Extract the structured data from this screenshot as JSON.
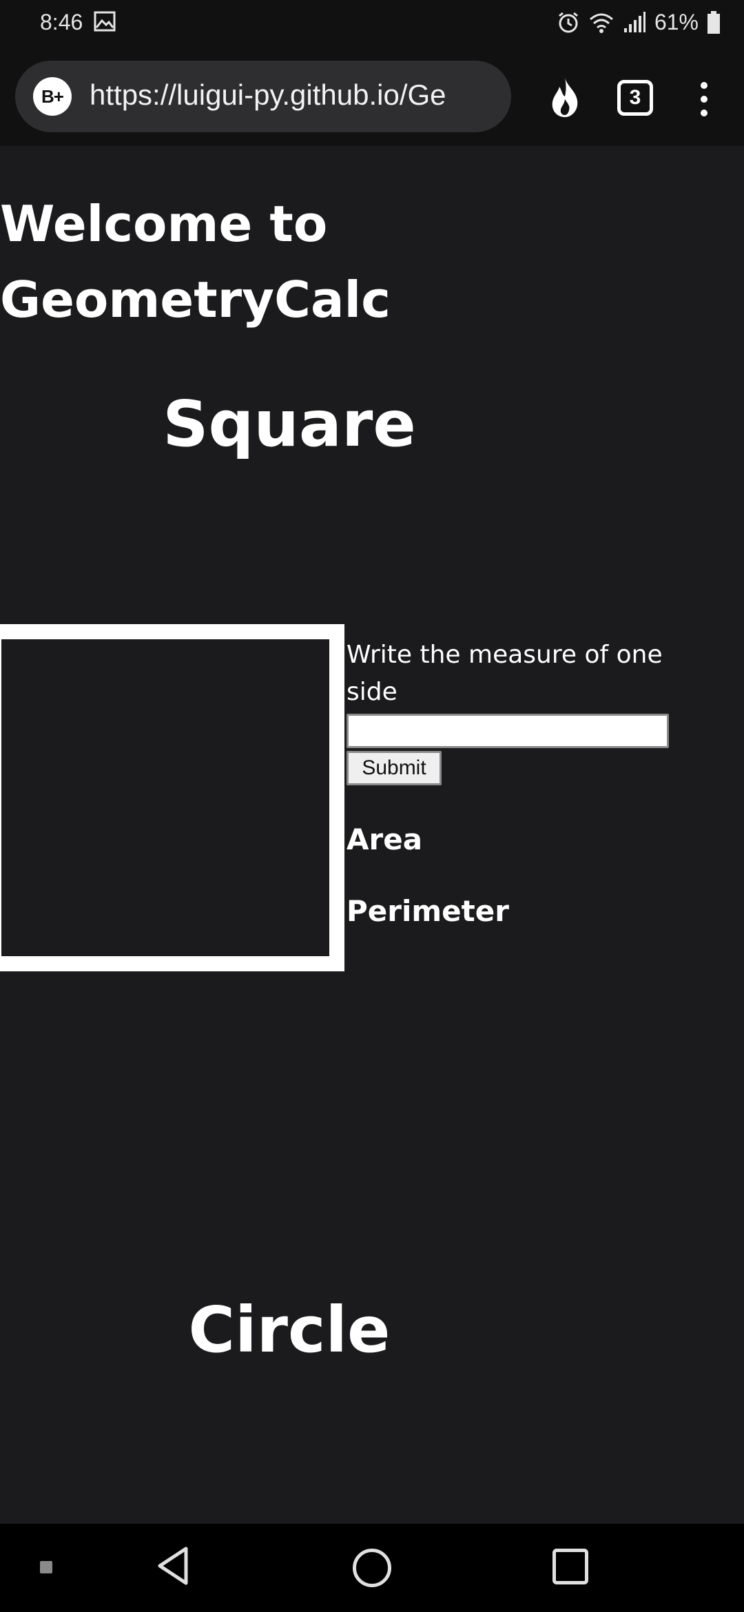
{
  "status_bar": {
    "time": "8:46",
    "battery": "61%"
  },
  "browser": {
    "site_badge": "B+",
    "url": "https://luigui-py.github.io/Ge",
    "tab_count": "3"
  },
  "page": {
    "heading": "Welcome to GeometryCalc",
    "square_section": {
      "title": "Square",
      "prompt": "Write the measure of one side",
      "input_value": "",
      "submit_label": "Submit",
      "area_label": "Area",
      "perimeter_label": "Perimeter"
    },
    "circle_section": {
      "title": "Circle"
    }
  },
  "colors": {
    "page_background": "#1b1b1d",
    "chrome_background": "#111111",
    "url_pill": "#2e2e30",
    "text": "#ffffff"
  },
  "icons": [
    "gallery-icon",
    "alarm-icon",
    "wifi-icon",
    "signal-icon",
    "battery-icon",
    "flame-icon",
    "tabs-icon",
    "more-menu-icon",
    "back-icon",
    "home-icon",
    "recents-icon"
  ]
}
